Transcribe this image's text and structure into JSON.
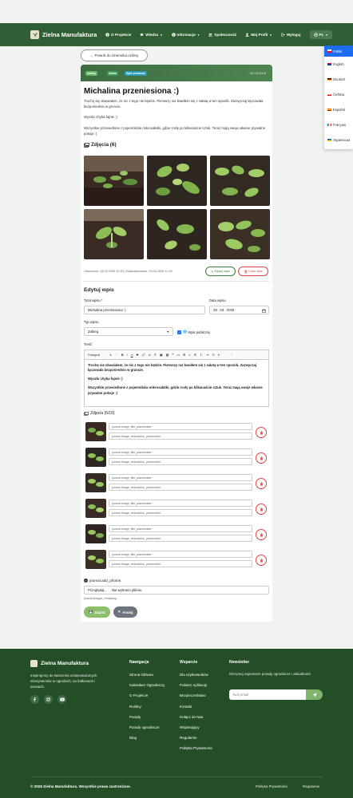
{
  "nav": {
    "brand": "Zielna Manufaktura",
    "items": [
      {
        "label": "O Projekcie",
        "icon": "info-icon"
      },
      {
        "label": "Wiedza",
        "icon": "graduation-cap-icon"
      },
      {
        "label": "Informacje",
        "icon": "info-circle-icon"
      },
      {
        "label": "Społeczność",
        "icon": "users-icon"
      },
      {
        "label": "Mój Profil",
        "icon": "user-icon"
      },
      {
        "label": "Wyloguj",
        "icon": "logout-icon"
      }
    ],
    "lang": "PL"
  },
  "languages": [
    {
      "label": "Polski",
      "active": true
    },
    {
      "label": "English"
    },
    {
      "label": "Deutsch"
    },
    {
      "label": "Čeština"
    },
    {
      "label": "Español"
    },
    {
      "label": "Français"
    },
    {
      "label": "Українська"
    }
  ],
  "back_label": "← Powrót do dziennika rośliny",
  "entry": {
    "badges": [
      "Zabieg",
      "Sałata",
      "Wpis publiczny"
    ],
    "date": "29.03.2026",
    "title": "Michalina przeniesiona :)",
    "p1": "Trochę się obawiałem, że nic z tego nie będzie. Pierwszy raz bawiłem się z sałatą w ten sposób. Zazwyczaj łączowała bezpośrednio w gruncie.",
    "p2": "Wyszło chyba fajnie :)",
    "p3": "Wszystkie przesiedlone z pojemników mikrosałatki, gdzie rosły po kilkanaście sztuk. Teraz mają swoje własne prywatne pokoje :)",
    "photos_heading": "Zdjęcia (6)",
    "meta": "Utworzono: 28.03.2026 10:33 | Zaktualizowano: 29.03.2026 11:45",
    "edit_label": "Edytuj wpis",
    "delete_label": "Usuń wpis"
  },
  "form": {
    "heading": "Edytuj wpis",
    "title_label": "Tytuł wpisu *",
    "title_value": "Michalina przeniesiona :)",
    "date_label": "Data wpisu",
    "date_value": "29 . 03 . 2026",
    "type_label": "Typ wpisu",
    "type_value": "Zabieg",
    "public_label": "Wpis publiczny",
    "content_label": "Treść",
    "toolbar_format": "Paragraf",
    "content_p1": "Trochę się obawiałem, że nic z tego nie będzie. Pierwszy raz bawiłem się z sałatą w ten sposób. Zazwyczaj łączowała bezpośrednio w gruncie.",
    "content_p2": "Wyszło chyba fajnie :)",
    "content_p3": "Wszystkie przesiedlone z pojemników mikrosałatki, gdzie rosły po kilkanaście sztuk. Teraz mają swoje własne prywatne pokoje :)",
    "photos_heading": "Zdjęcia (6/15)",
    "title_placeholder": "journal.image_title_placeholder",
    "desc_placeholder": "journal.image_description_placeholder",
    "add_photos": "journal.add_photos",
    "browse": "Przeglądaj...",
    "no_file": "Nie wybrano plików.",
    "remaining": "journal.images_remaining",
    "save": "Zapisz",
    "cancel": "Anuluj"
  },
  "footer": {
    "brand": "Zielna Manufaktura",
    "desc": "Inspirujemy do tworzenia zrównoważonych ekosystemów w ogrodach, na balkonach i tarasach.",
    "col1_title": "Nawigacja",
    "col1": [
      "Strona Główna",
      "Kalendarz Ogrodniczy",
      "O Projekcie",
      "Rośliny",
      "Porady",
      "Porady ogrodnicze",
      "Blog"
    ],
    "col2_title": "Wsparcie",
    "col2": [
      "Dla użytkowników",
      "Pobierz Aplikację",
      "Bezpieczeństwo",
      "Kontakt",
      "Dołącz do Nas",
      "Wspierający",
      "Regulamin",
      "Polityka Prywatności"
    ],
    "col3_title": "Newsletter",
    "nl_text": "Otrzymuj najnowsze porady ogrodnicze i aktualności",
    "nl_placeholder": "Twój email",
    "copyright": "© 2026 Zielna Manufaktura. Wszystkie prawa zastrzeżone.",
    "link_privacy": "Polityka Prywatności",
    "link_terms": "Regulamin"
  },
  "colors": {
    "brand_green": "#2f5f33",
    "footer_green": "#234e26",
    "accent_blue": "#1e6cf0",
    "danger": "#d44444"
  }
}
